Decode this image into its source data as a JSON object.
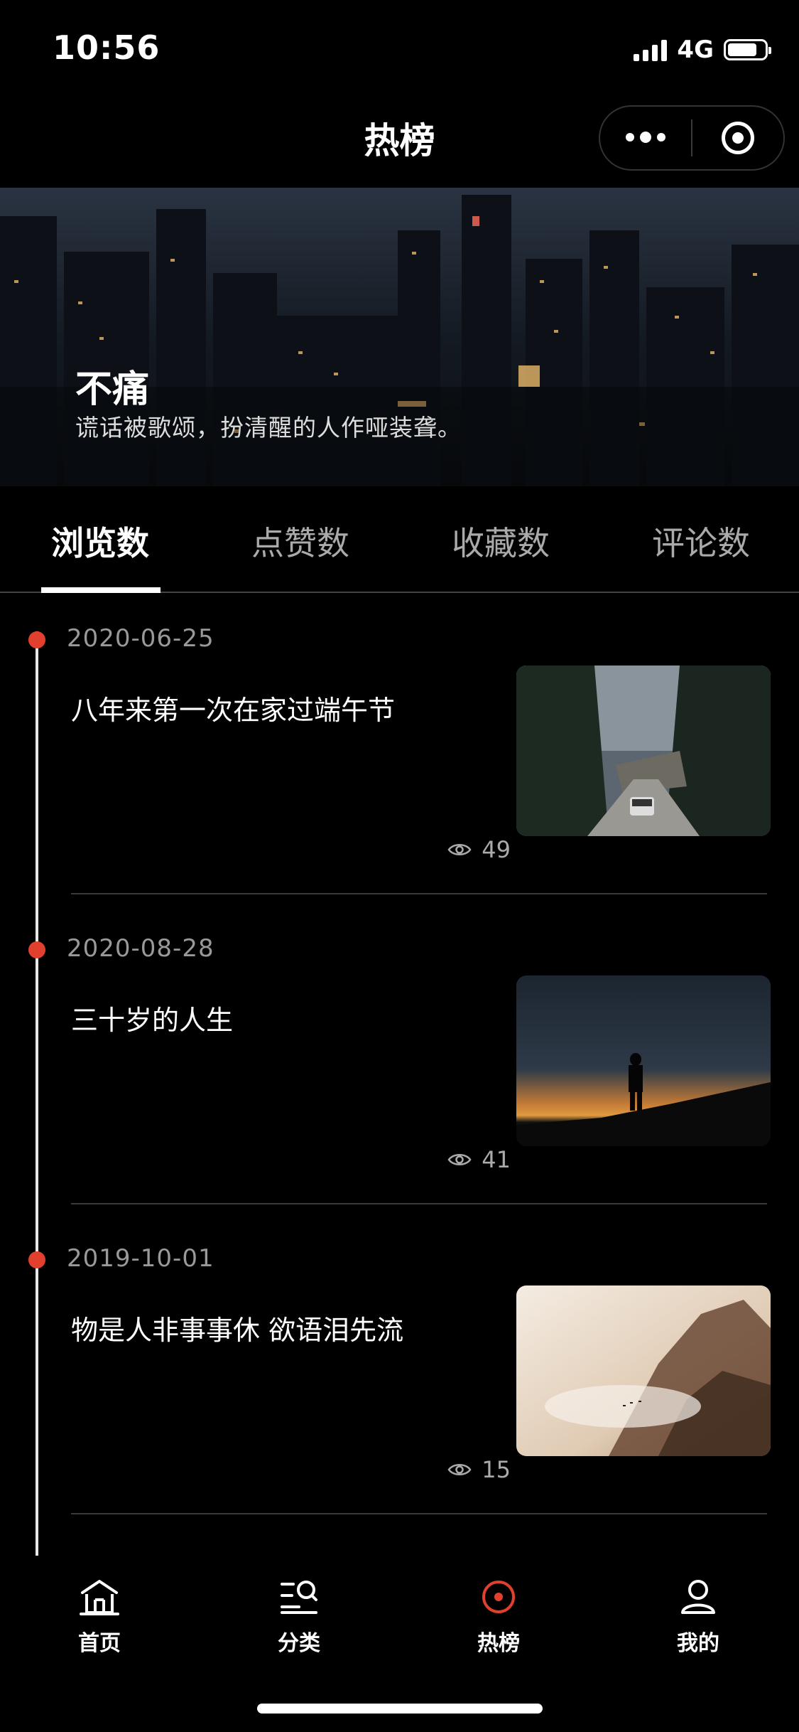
{
  "status_bar": {
    "time": "10:56",
    "network": "4G"
  },
  "nav": {
    "title": "热榜",
    "more_icon": "more-dots-icon",
    "target_icon": "target-icon"
  },
  "banner": {
    "title": "不痛",
    "subtitle": "谎话被歌颂，扮清醒的人作哑装聋。"
  },
  "tabs": [
    {
      "label": "浏览数",
      "active": true
    },
    {
      "label": "点赞数",
      "active": false
    },
    {
      "label": "收藏数",
      "active": false
    },
    {
      "label": "评论数",
      "active": false
    }
  ],
  "posts": [
    {
      "date": "2020-06-25",
      "title": "八年来第一次在家过端午节",
      "views": "49"
    },
    {
      "date": "2020-08-28",
      "title": "三十岁的人生",
      "views": "41"
    },
    {
      "date": "2019-10-01",
      "title": "物是人非事事休 欲语泪先流",
      "views": "15"
    }
  ],
  "tabbar": [
    {
      "label": "首页",
      "icon": "home-icon",
      "active": false
    },
    {
      "label": "分类",
      "icon": "category-search-icon",
      "active": false
    },
    {
      "label": "热榜",
      "icon": "hot-target-icon",
      "active": true
    },
    {
      "label": "我的",
      "icon": "profile-icon",
      "active": false
    }
  ],
  "colors": {
    "accent": "#e0402d",
    "background": "#000000"
  }
}
